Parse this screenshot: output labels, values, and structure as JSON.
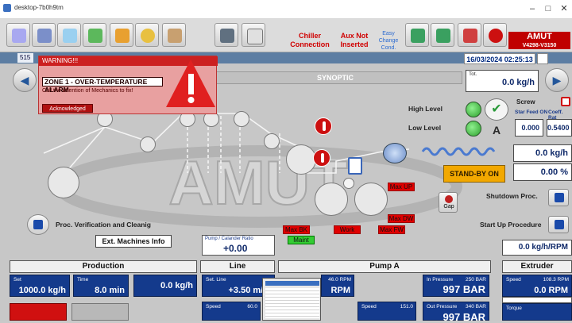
{
  "window": {
    "title": "desktop-7b0h9tm"
  },
  "header": {
    "chiller": "Chiller Connection",
    "aux": "Aux Not Inserted",
    "easy": "Easy Change Cond.",
    "logo": "AMUT",
    "model": "V4298-V3150",
    "datetime": "16/03/2024 02:25:13",
    "status_num": "515"
  },
  "alarm": {
    "title": "WARNING!!!",
    "zone": "ZONE 1 - OVER-TEMPERATURE ALARM",
    "message": "Call the attention of Mechanics to fix!",
    "ack": "Acknowledged"
  },
  "synoptic": {
    "title": "SYNOPTIC"
  },
  "tot": {
    "label": "Tot.",
    "value": "0.0 kg/h"
  },
  "levels": {
    "high": "High Level",
    "low": "Low Level",
    "letter": "A"
  },
  "screw": {
    "label": "Screw",
    "feed_label": "Star Feed ON",
    "coeff_label": "Coeff. Rat",
    "feed_value": "0.000",
    "coeff_value": "0.5400"
  },
  "right": {
    "kgh": "0.0 kg/h",
    "pct": "0.00 %",
    "standby": "STAND-BY ON",
    "shutdown": "Shutdown Proc.",
    "startup": "Start Up Procedure",
    "kgh_rpm": "0.0 kg/h/RPM"
  },
  "process": {
    "max_up": "Max UP",
    "max_dw": "Max DW",
    "max_fw": "Max FW",
    "max_bk": "Max BK",
    "work": "Work",
    "maint": "Maint",
    "gap": "Gap"
  },
  "left": {
    "proc_verif": "Proc. Verification and Cleanig",
    "ext_info": "Ext. Machines Info"
  },
  "pump_ratio": {
    "label": "Pump / Calander Ratio",
    "value": "+0.00"
  },
  "panels": {
    "production": "Production",
    "line": "Line",
    "pump": "Pump A",
    "extruder": "Extruder"
  },
  "production": {
    "set_label": "Set",
    "set_value": "1000.0 kg/h",
    "time_label": "Time",
    "time_value": "8.0 min",
    "actual_value": "0.0 kg/h"
  },
  "line": {
    "set_label": "Set. Line",
    "set_value": "+3.50 m/m",
    "speed_label": "Speed",
    "speed_max": "60.0"
  },
  "pump": {
    "rpm_max": "46.0 RPM",
    "rpm_value": "RPM",
    "inpress_label": "In Pressure",
    "inpress_max": "250 BAR",
    "inpress_value": "997 BAR",
    "speed_label": "Speed",
    "speed_max": "151.0",
    "outpress_label": "Out Pressure",
    "outpress_max": "340 BAR",
    "outpress_value": "997 BAR"
  },
  "extruder": {
    "speed_label": "Speed",
    "speed_max": "108.3 RPM",
    "speed_value": "0.0 RPM",
    "torque_label": "Torque"
  },
  "colors": {
    "accent": "#143a8c",
    "alarm": "#cc2020",
    "standby": "#f2a800"
  }
}
